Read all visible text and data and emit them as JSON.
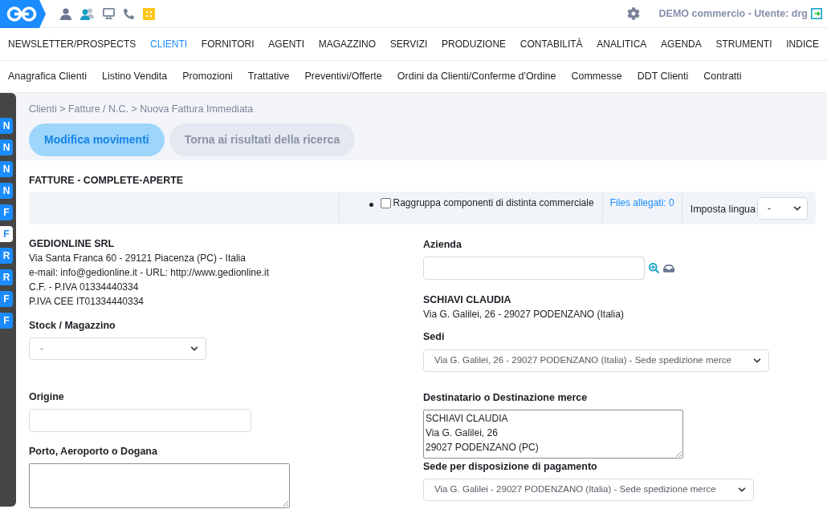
{
  "header": {
    "user_label": "DEMO commercio - Utente: drg"
  },
  "main_menu": [
    {
      "label": "NEWSLETTER/PROSPECTS",
      "selected": false
    },
    {
      "label": "CLIENTI",
      "selected": true
    },
    {
      "label": "FORNITORI",
      "selected": false
    },
    {
      "label": "AGENTI",
      "selected": false
    },
    {
      "label": "MAGAZZINO",
      "selected": false
    },
    {
      "label": "SERVIZI",
      "selected": false
    },
    {
      "label": "PRODUZIONE",
      "selected": false
    },
    {
      "label": "CONTABILITÀ",
      "selected": false
    },
    {
      "label": "ANALITICA",
      "selected": false
    },
    {
      "label": "AGENDA",
      "selected": false
    },
    {
      "label": "STRUMENTI",
      "selected": false
    },
    {
      "label": "INDICE",
      "selected": false
    }
  ],
  "sub_menu": [
    "Anagrafica Clienti",
    "Listino Vendita",
    "Promozioni",
    "Trattative",
    "Preventivi/Offerte",
    "Ordini da Clienti/Conferme d'Ordine",
    "Commesse",
    "DDT Clienti",
    "Contratti"
  ],
  "side_tabs": [
    {
      "label": "N",
      "selected": false
    },
    {
      "label": "N",
      "selected": false
    },
    {
      "label": "N",
      "selected": false
    },
    {
      "label": "N",
      "selected": false
    },
    {
      "label": "F",
      "selected": false
    },
    {
      "label": "F",
      "selected": true
    },
    {
      "label": "R",
      "selected": false
    },
    {
      "label": "R",
      "selected": false
    },
    {
      "label": "F",
      "selected": false
    },
    {
      "label": "F",
      "selected": false
    }
  ],
  "breadcrumb": "Clienti > Fatture / N.C. > Nuova Fattura Immediata",
  "action_buttons": [
    {
      "label": "Modifica movimenti",
      "selected": true
    },
    {
      "label": "Torna ai risultati della ricerca",
      "selected": false
    }
  ],
  "section_title": "FATTURE - COMPLETE-APERTE",
  "toolbar": {
    "group_option": {
      "label": "Raggruppa componenti di distinta commerciale",
      "checked": false
    },
    "attachments_link": "Files allegati: 0",
    "language": {
      "label": "Imposta lingua",
      "value": "-"
    }
  },
  "issuer": {
    "name": "GEDIONLINE SRL",
    "lines": [
      "Via Santa Franca 60 - 29121 Piacenza (PC) - Italia",
      "e-mail: info@gedionline.it - URL: http://www.gedionline.it",
      "C.F. - P.IVA 01334440334",
      "P.IVA CEE IT01334440334"
    ]
  },
  "left_fields": [
    {
      "kind": "select",
      "label": "Stock / Magazzino",
      "value": "-"
    },
    {
      "kind": "input",
      "label": "Origine"
    },
    {
      "kind": "textarea",
      "label": "Porto, Aeroporto o Dogana"
    }
  ],
  "company_field": {
    "label": "Azienda"
  },
  "customer": {
    "name": "SCHIAVI CLAUDIA",
    "address": "Via G. Galilei, 26 - 29027 PODENZANO (Italia)"
  },
  "right_fields": [
    {
      "kind": "select",
      "label": "Sedi",
      "value": "Via G. Galilei, 26 - 29027 PODENZANO (Italia) - Sede spedizione merce"
    },
    {
      "kind": "textarea",
      "label": "Destinatario o Destinazione merce",
      "value": "SCHIAVI CLAUDIA\nVia G. Galilei, 26\n29027 PODENZANO (PC)"
    },
    {
      "kind": "select",
      "label": "Sede per disposizione di pagamento",
      "value": "Via G. Galilei - 29027 PODENZANO (Italia) - Sede spedizione merce"
    }
  ]
}
